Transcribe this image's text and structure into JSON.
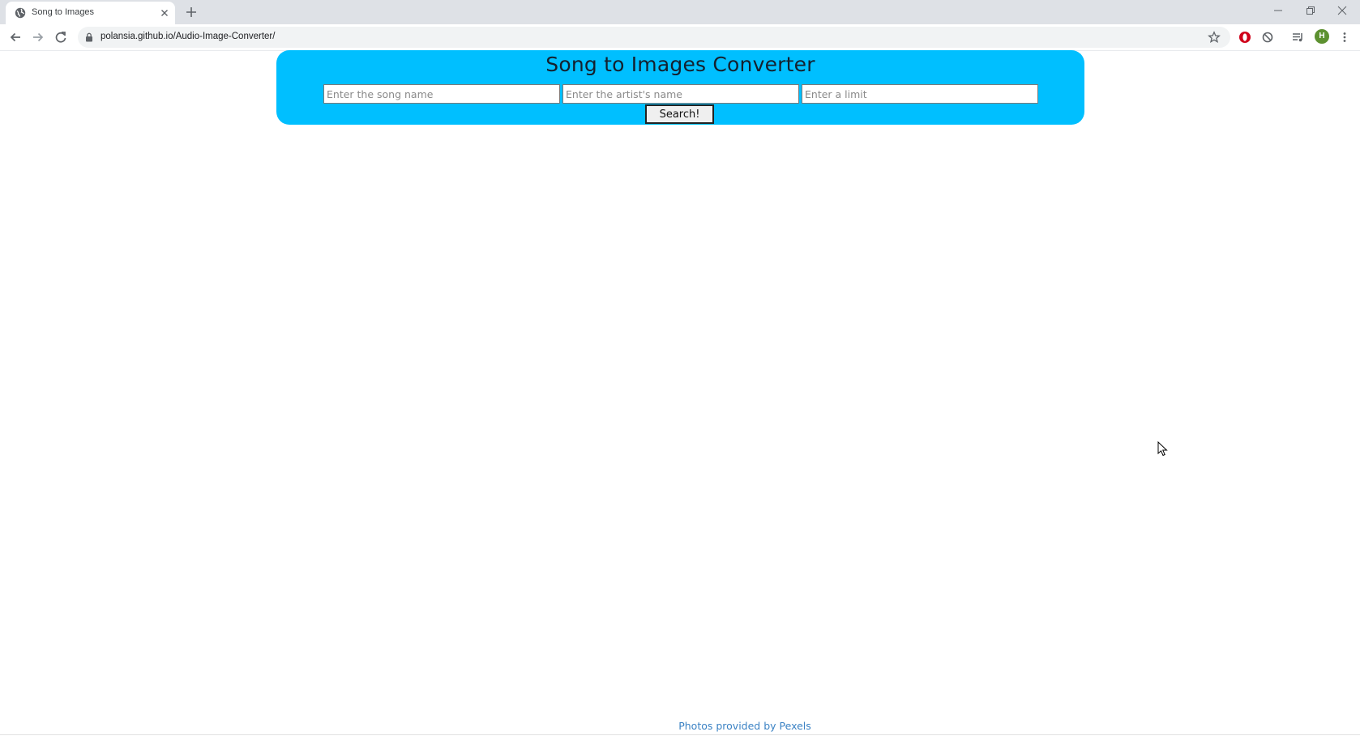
{
  "browser": {
    "tab_title": "Song to Images",
    "url": "polansia.github.io/Audio-Image-Converter/",
    "profile_initial": "H"
  },
  "page": {
    "title": "Song to Images Converter",
    "song_placeholder": "Enter the song name",
    "artist_placeholder": "Enter the artist's name",
    "limit_placeholder": "Enter a limit",
    "search_label": "Search!",
    "footer_text": "Photos provided by Pexels"
  },
  "colors": {
    "panel_background": "#00bfff",
    "footer_link": "#3b82c4"
  },
  "icons": {
    "favicon": "globe-icon",
    "tab_close": "close-icon",
    "new_tab": "plus-icon",
    "back": "arrow-left-icon",
    "forward": "arrow-right-icon",
    "reload": "reload-icon",
    "lock": "lock-icon",
    "bookmark": "star-icon",
    "extension_1": "opera-icon",
    "extension_2": "block-icon",
    "media": "media-control-icon",
    "menu": "kebab-menu-icon"
  }
}
